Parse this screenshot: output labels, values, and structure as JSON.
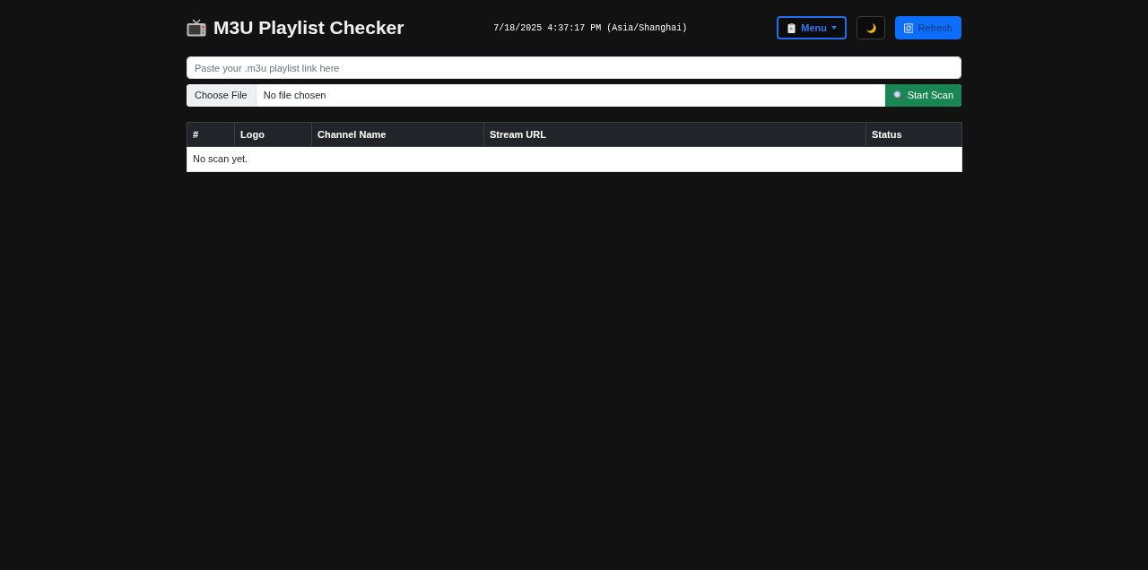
{
  "header": {
    "title": "M3U Playlist Checker",
    "datetime": "7/18/2025 4:37:17 PM (Asia/Shanghai)",
    "menu_button": {
      "label": "Menu"
    },
    "refresh_button": {
      "label": "Refresh"
    }
  },
  "url_field": {
    "placeholder": "Paste your .m3u playlist link here"
  },
  "file_input": {
    "button": "Choose File",
    "status": "No file chosen"
  },
  "scan_button": {
    "label": "Start Scan"
  },
  "table": {
    "columns": [
      "#",
      "Logo",
      "Channel Name",
      "Stream URL",
      "Status"
    ],
    "empty_message": "No scan yet."
  }
}
